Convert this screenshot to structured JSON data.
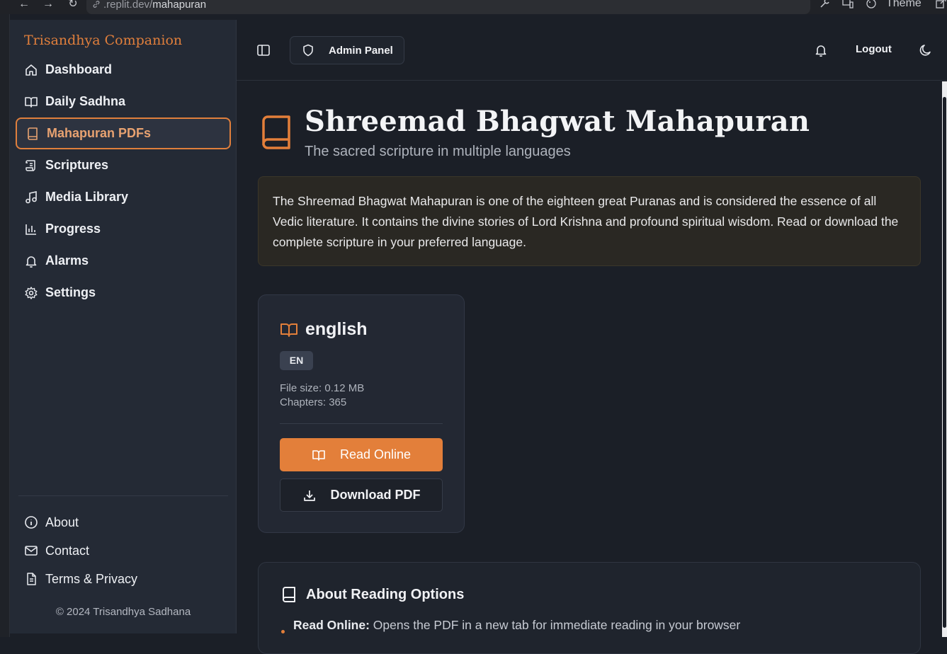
{
  "browser": {
    "url_dim": ".replit.dev/",
    "url_path": "mahapuran",
    "theme_label": "Theme"
  },
  "sidebar": {
    "brand": "Trisandhya Companion",
    "items": [
      {
        "label": "Dashboard",
        "icon": "home-icon"
      },
      {
        "label": "Daily Sadhna",
        "icon": "open-book-icon"
      },
      {
        "label": "Mahapuran PDFs",
        "icon": "book-icon",
        "active": true
      },
      {
        "label": "Scriptures",
        "icon": "scroll-icon"
      },
      {
        "label": "Media Library",
        "icon": "music-icon"
      },
      {
        "label": "Progress",
        "icon": "bar-chart-icon"
      },
      {
        "label": "Alarms",
        "icon": "bell-icon"
      },
      {
        "label": "Settings",
        "icon": "gear-icon"
      }
    ],
    "footer_items": [
      {
        "label": "About",
        "icon": "info-icon"
      },
      {
        "label": "Contact",
        "icon": "mail-icon"
      },
      {
        "label": "Terms & Privacy",
        "icon": "document-icon"
      }
    ],
    "copyright": "© 2024 Trisandhya Sadhana"
  },
  "header": {
    "admin_label": "Admin Panel",
    "logout_label": "Logout"
  },
  "main": {
    "title": "Shreemad Bhagwat Mahapuran",
    "subtitle": "The sacred scripture in multiple languages",
    "intro": "The Shreemad Bhagwat Mahapuran is one of the eighteen great Puranas and is considered the essence of all Vedic literature. It contains the divine stories of Lord Krishna and profound spiritual wisdom. Read or download the complete scripture in your preferred language.",
    "card": {
      "title": "english",
      "badge": "EN",
      "file_size": "File size: 0.12 MB",
      "chapters": "Chapters: 365",
      "read_label": "Read Online",
      "download_label": "Download PDF"
    },
    "about": {
      "title": "About Reading Options",
      "item_bold": "Read Online:",
      "item_text": " Opens the PDF in a new tab for immediate reading in your browser"
    }
  },
  "colors": {
    "accent": "#e37f3a",
    "background": "#1b1f27",
    "sidebar": "#242a35"
  }
}
